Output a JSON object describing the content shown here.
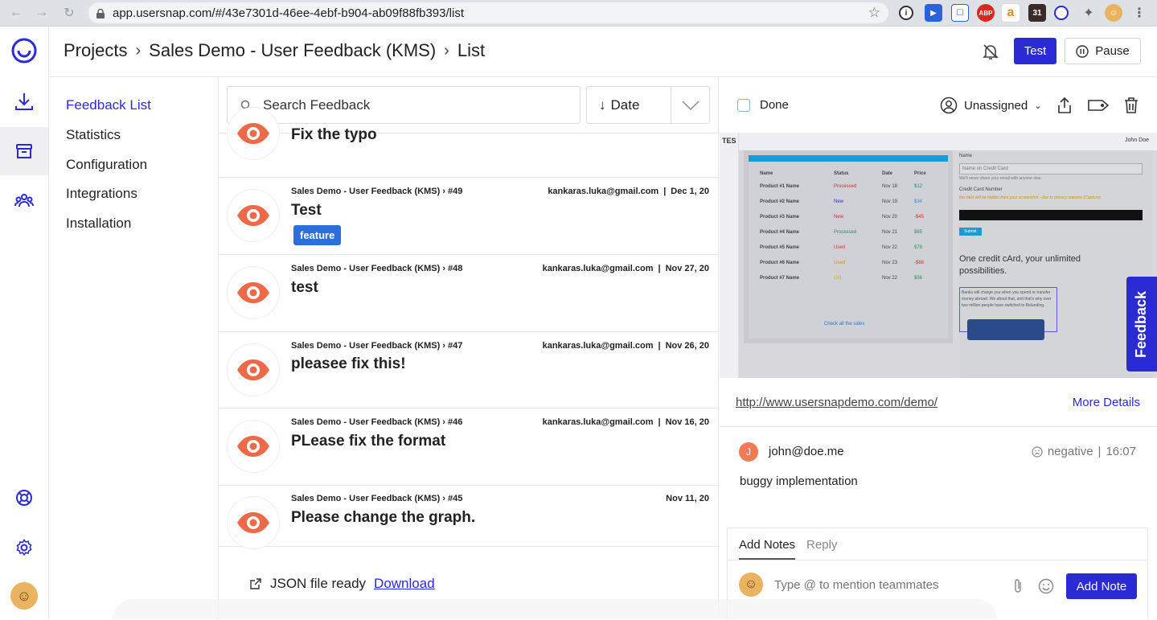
{
  "browser": {
    "url": "app.usersnap.com/#/43e7301d-46ee-4ebf-b904-ab09f88fb393/list"
  },
  "header": {
    "crumbs": [
      "Projects",
      "Sales Demo - User Feedback (KMS)",
      "List"
    ],
    "test_label": "Test",
    "pause_label": "Pause"
  },
  "subnav": {
    "items": [
      "Feedback List",
      "Statistics",
      "Configuration",
      "Integrations",
      "Installation"
    ]
  },
  "list": {
    "search_placeholder": "Search Feedback",
    "sort_label": "Date",
    "partial_title": "Fix the typo",
    "rows": [
      {
        "project": "Sales Demo - User Feedback (KMS) › #49",
        "email": "kankaras.luka@gmail.com",
        "date": "Dec 1, 20",
        "title": "Test",
        "tag": "feature"
      },
      {
        "project": "Sales Demo - User Feedback (KMS) › #48",
        "email": "kankaras.luka@gmail.com",
        "date": "Nov 27, 20",
        "title": "test"
      },
      {
        "project": "Sales Demo - User Feedback (KMS) › #47",
        "email": "kankaras.luka@gmail.com",
        "date": "Nov 26, 20",
        "title": "pleasee fix this!"
      },
      {
        "project": "Sales Demo - User Feedback (KMS) › #46",
        "email": "kankaras.luka@gmail.com",
        "date": "Nov 16, 20",
        "title": "PLease fix the format"
      },
      {
        "project": "Sales Demo - User Feedback (KMS) › #45",
        "email": "",
        "date": "Nov 11, 20",
        "title": "Please change the graph."
      }
    ],
    "json_text": "JSON file ready",
    "json_link": "Download"
  },
  "detail": {
    "done_label": "Done",
    "assignee": "Unassigned",
    "url": "http://www.usersnapdemo.com/demo/",
    "more_details": "More Details",
    "comment": {
      "avatar_initial": "J",
      "email": "john@doe.me",
      "sentiment": "negative",
      "time": "16:07",
      "text": "buggy implementation"
    },
    "notes": {
      "tab_notes": "Add Notes",
      "tab_reply": "Reply",
      "placeholder": "Type @ to mention teammates",
      "add_note": "Add Note"
    },
    "screenshot": {
      "brand": "TES",
      "user": "John Doe",
      "table_headers": [
        "Name",
        "Status",
        "Date",
        "Price"
      ],
      "rows": [
        {
          "name": "Product #1 Name",
          "status": "Processed",
          "date": "Nov 18",
          "price": "$12"
        },
        {
          "name": "Product #2 Name",
          "status": "New",
          "date": "Nov 19",
          "price": "$34"
        },
        {
          "name": "Product #3 Name",
          "status": "New",
          "date": "Nov 20",
          "price": "-$45"
        },
        {
          "name": "Product #4 Name",
          "status": "Processed",
          "date": "Nov 21",
          "price": "$65"
        },
        {
          "name": "Product #5 Name",
          "status": "Used",
          "date": "Nov 22",
          "price": "$78"
        },
        {
          "name": "Product #6 Name",
          "status": "Used",
          "date": "Nov 23",
          "price": "-$88"
        },
        {
          "name": "Product #7 Name",
          "status": "Old",
          "date": "Nov 22",
          "price": "$56"
        }
      ],
      "check_all": "Check all the sales",
      "form_name_label": "Name",
      "form_name_placeholder": "Name on Credit Card",
      "form_help": "We'll never share your email with anyone else.",
      "cc_label": "Credit Card Number",
      "cc_warning": "this field will be hidden from your screenshot - due to privacy reasons (Capture)",
      "submit": "Submit",
      "promo": "One credit cArd, your unlimited possibilities.",
      "promo_small": "Banks will charge you when you spend or transfer money abroad. We about that, and that's why over two million people have switched to Belanding."
    },
    "feedback_tab": "Feedback"
  }
}
